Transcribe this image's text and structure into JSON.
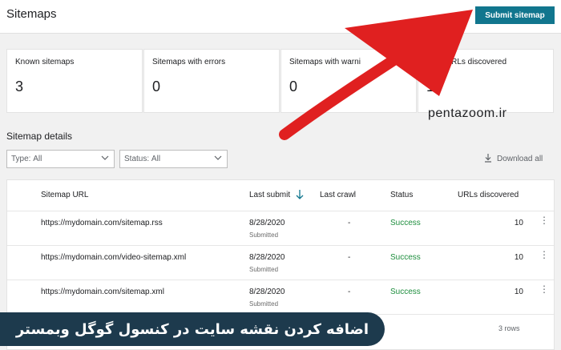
{
  "header": {
    "title": "Sitemaps",
    "submit_label": "Submit sitemap"
  },
  "summary_cards": [
    {
      "label": "Known sitemaps",
      "value": "3"
    },
    {
      "label": "Sitemaps with errors",
      "value": "0"
    },
    {
      "label": "Sitemaps with warni",
      "value": "0"
    },
    {
      "label": "Total URLs discovered",
      "value": "10"
    }
  ],
  "details": {
    "title": "Sitemap details",
    "filters": {
      "type": {
        "prefix": "Type:",
        "value": "All"
      },
      "status": {
        "prefix": "Status:",
        "value": "All"
      }
    },
    "download_label": "Download all"
  },
  "watermark": "pentazoom.ir",
  "table": {
    "columns": [
      "Sitemap URL",
      "Last submit",
      "Last crawl",
      "Status",
      "URLs discovered"
    ],
    "rows": [
      {
        "url": "https://mydomain.com/sitemap.rss",
        "last_submit": "8/28/2020",
        "submit_note": "Submitted",
        "last_crawl": "-",
        "status": "Success",
        "urls": "10"
      },
      {
        "url": "https://mydomain.com/video-sitemap.xml",
        "last_submit": "8/28/2020",
        "submit_note": "Submitted",
        "last_crawl": "-",
        "status": "Success",
        "urls": "10"
      },
      {
        "url": "https://mydomain.com/sitemap.xml",
        "last_submit": "8/28/2020",
        "submit_note": "Submitted",
        "last_crawl": "-",
        "status": "Success",
        "urls": "10"
      }
    ],
    "rows_count": "3 rows"
  },
  "banner": {
    "text": "اضافه کردن نقشه سایت در کنسول گوگل وبمستر"
  },
  "colors": {
    "accent": "#11768e",
    "success": "#1e8e3e",
    "arrow": "#e02020",
    "banner": "#1d3a4d"
  },
  "icons": {
    "sort": "arrow-down-icon",
    "download": "download-icon",
    "filter_chevron": "chevron-down-icon",
    "row_menu": "more-vert-icon"
  }
}
